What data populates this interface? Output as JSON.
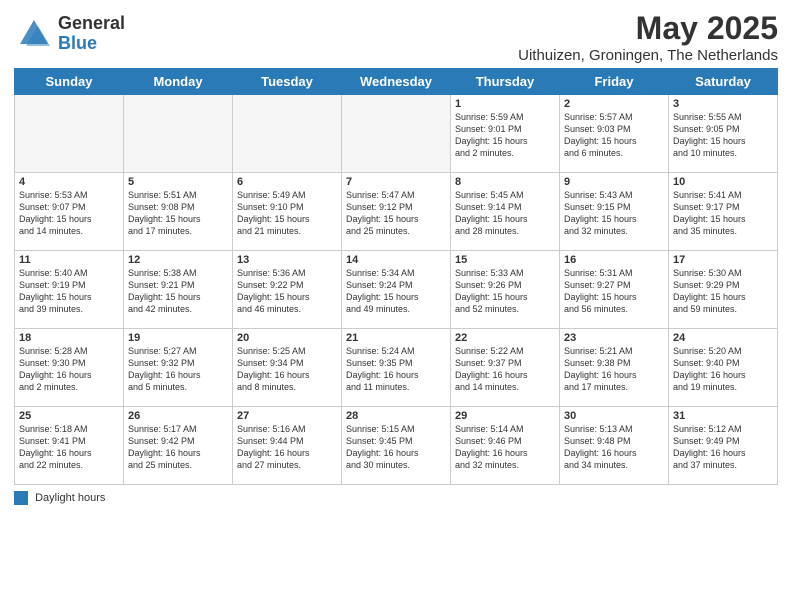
{
  "header": {
    "logo_general": "General",
    "logo_blue": "Blue",
    "title": "May 2025",
    "subtitle": "Uithuizen, Groningen, The Netherlands"
  },
  "days_of_week": [
    "Sunday",
    "Monday",
    "Tuesday",
    "Wednesday",
    "Thursday",
    "Friday",
    "Saturday"
  ],
  "legend": "Daylight hours",
  "weeks": [
    [
      {
        "day": "",
        "info": "",
        "empty": true
      },
      {
        "day": "",
        "info": "",
        "empty": true
      },
      {
        "day": "",
        "info": "",
        "empty": true
      },
      {
        "day": "",
        "info": "",
        "empty": true
      },
      {
        "day": "1",
        "info": "Sunrise: 5:59 AM\nSunset: 9:01 PM\nDaylight: 15 hours\nand 2 minutes.",
        "empty": false
      },
      {
        "day": "2",
        "info": "Sunrise: 5:57 AM\nSunset: 9:03 PM\nDaylight: 15 hours\nand 6 minutes.",
        "empty": false
      },
      {
        "day": "3",
        "info": "Sunrise: 5:55 AM\nSunset: 9:05 PM\nDaylight: 15 hours\nand 10 minutes.",
        "empty": false
      }
    ],
    [
      {
        "day": "4",
        "info": "Sunrise: 5:53 AM\nSunset: 9:07 PM\nDaylight: 15 hours\nand 14 minutes.",
        "empty": false
      },
      {
        "day": "5",
        "info": "Sunrise: 5:51 AM\nSunset: 9:08 PM\nDaylight: 15 hours\nand 17 minutes.",
        "empty": false
      },
      {
        "day": "6",
        "info": "Sunrise: 5:49 AM\nSunset: 9:10 PM\nDaylight: 15 hours\nand 21 minutes.",
        "empty": false
      },
      {
        "day": "7",
        "info": "Sunrise: 5:47 AM\nSunset: 9:12 PM\nDaylight: 15 hours\nand 25 minutes.",
        "empty": false
      },
      {
        "day": "8",
        "info": "Sunrise: 5:45 AM\nSunset: 9:14 PM\nDaylight: 15 hours\nand 28 minutes.",
        "empty": false
      },
      {
        "day": "9",
        "info": "Sunrise: 5:43 AM\nSunset: 9:15 PM\nDaylight: 15 hours\nand 32 minutes.",
        "empty": false
      },
      {
        "day": "10",
        "info": "Sunrise: 5:41 AM\nSunset: 9:17 PM\nDaylight: 15 hours\nand 35 minutes.",
        "empty": false
      }
    ],
    [
      {
        "day": "11",
        "info": "Sunrise: 5:40 AM\nSunset: 9:19 PM\nDaylight: 15 hours\nand 39 minutes.",
        "empty": false
      },
      {
        "day": "12",
        "info": "Sunrise: 5:38 AM\nSunset: 9:21 PM\nDaylight: 15 hours\nand 42 minutes.",
        "empty": false
      },
      {
        "day": "13",
        "info": "Sunrise: 5:36 AM\nSunset: 9:22 PM\nDaylight: 15 hours\nand 46 minutes.",
        "empty": false
      },
      {
        "day": "14",
        "info": "Sunrise: 5:34 AM\nSunset: 9:24 PM\nDaylight: 15 hours\nand 49 minutes.",
        "empty": false
      },
      {
        "day": "15",
        "info": "Sunrise: 5:33 AM\nSunset: 9:26 PM\nDaylight: 15 hours\nand 52 minutes.",
        "empty": false
      },
      {
        "day": "16",
        "info": "Sunrise: 5:31 AM\nSunset: 9:27 PM\nDaylight: 15 hours\nand 56 minutes.",
        "empty": false
      },
      {
        "day": "17",
        "info": "Sunrise: 5:30 AM\nSunset: 9:29 PM\nDaylight: 15 hours\nand 59 minutes.",
        "empty": false
      }
    ],
    [
      {
        "day": "18",
        "info": "Sunrise: 5:28 AM\nSunset: 9:30 PM\nDaylight: 16 hours\nand 2 minutes.",
        "empty": false
      },
      {
        "day": "19",
        "info": "Sunrise: 5:27 AM\nSunset: 9:32 PM\nDaylight: 16 hours\nand 5 minutes.",
        "empty": false
      },
      {
        "day": "20",
        "info": "Sunrise: 5:25 AM\nSunset: 9:34 PM\nDaylight: 16 hours\nand 8 minutes.",
        "empty": false
      },
      {
        "day": "21",
        "info": "Sunrise: 5:24 AM\nSunset: 9:35 PM\nDaylight: 16 hours\nand 11 minutes.",
        "empty": false
      },
      {
        "day": "22",
        "info": "Sunrise: 5:22 AM\nSunset: 9:37 PM\nDaylight: 16 hours\nand 14 minutes.",
        "empty": false
      },
      {
        "day": "23",
        "info": "Sunrise: 5:21 AM\nSunset: 9:38 PM\nDaylight: 16 hours\nand 17 minutes.",
        "empty": false
      },
      {
        "day": "24",
        "info": "Sunrise: 5:20 AM\nSunset: 9:40 PM\nDaylight: 16 hours\nand 19 minutes.",
        "empty": false
      }
    ],
    [
      {
        "day": "25",
        "info": "Sunrise: 5:18 AM\nSunset: 9:41 PM\nDaylight: 16 hours\nand 22 minutes.",
        "empty": false
      },
      {
        "day": "26",
        "info": "Sunrise: 5:17 AM\nSunset: 9:42 PM\nDaylight: 16 hours\nand 25 minutes.",
        "empty": false
      },
      {
        "day": "27",
        "info": "Sunrise: 5:16 AM\nSunset: 9:44 PM\nDaylight: 16 hours\nand 27 minutes.",
        "empty": false
      },
      {
        "day": "28",
        "info": "Sunrise: 5:15 AM\nSunset: 9:45 PM\nDaylight: 16 hours\nand 30 minutes.",
        "empty": false
      },
      {
        "day": "29",
        "info": "Sunrise: 5:14 AM\nSunset: 9:46 PM\nDaylight: 16 hours\nand 32 minutes.",
        "empty": false
      },
      {
        "day": "30",
        "info": "Sunrise: 5:13 AM\nSunset: 9:48 PM\nDaylight: 16 hours\nand 34 minutes.",
        "empty": false
      },
      {
        "day": "31",
        "info": "Sunrise: 5:12 AM\nSunset: 9:49 PM\nDaylight: 16 hours\nand 37 minutes.",
        "empty": false
      }
    ]
  ]
}
